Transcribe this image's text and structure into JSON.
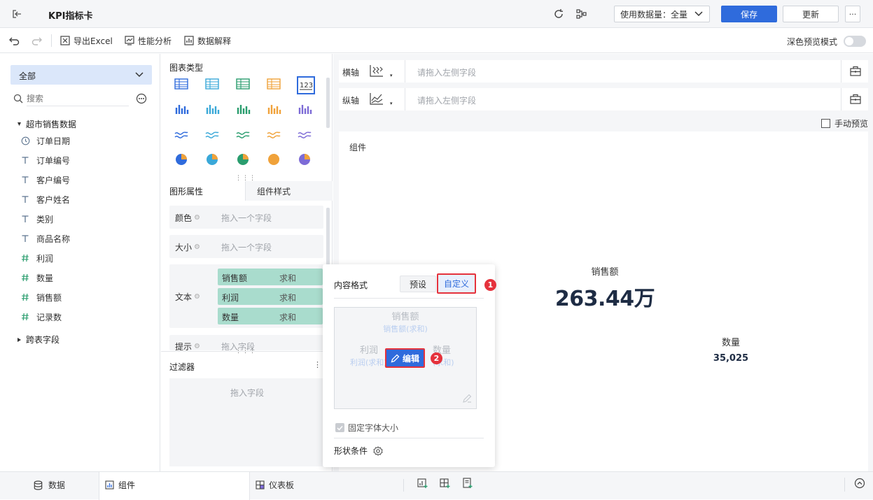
{
  "topbar": {
    "title": "KPI指标卡",
    "data_usage_label": "使用数据量：",
    "data_usage_value": "全量",
    "save_label": "保存",
    "update_label": "更新",
    "more_label": "···"
  },
  "toolbar": {
    "export_label": "导出Excel",
    "performance_label": "性能分析",
    "explain_label": "数据解释",
    "dark_preview_label": "深色预览模式"
  },
  "left": {
    "scope_value": "全部",
    "search_placeholder": "搜索",
    "dataset_name": "超市销售数据",
    "fields": [
      {
        "label": "订单日期",
        "type": "date"
      },
      {
        "label": "订单编号",
        "type": "text"
      },
      {
        "label": "客户编号",
        "type": "text"
      },
      {
        "label": "客户姓名",
        "type": "text"
      },
      {
        "label": "类别",
        "type": "text"
      },
      {
        "label": "商品名称",
        "type": "text"
      },
      {
        "label": "利润",
        "type": "number"
      },
      {
        "label": "数量",
        "type": "number"
      },
      {
        "label": "销售额",
        "type": "number"
      },
      {
        "label": "记录数",
        "type": "number"
      }
    ],
    "cross_table_label": "跨表字段"
  },
  "middle": {
    "chart_type_title": "图表类型",
    "tab_graphic": "图形属性",
    "tab_component": "组件样式",
    "color_label": "颜色",
    "size_label": "大小",
    "text_label": "文本",
    "tooltip_label": "提示",
    "drop_one_placeholder": "拖入一个字段",
    "drop_field_placeholder": "拖入字段",
    "text_pills": [
      {
        "name": "销售额",
        "agg": "求和"
      },
      {
        "name": "利润",
        "agg": "求和"
      },
      {
        "name": "数量",
        "agg": "求和"
      }
    ],
    "filter_title": "过滤器",
    "filter_placeholder": "拖入字段"
  },
  "right": {
    "x_axis_label": "横轴",
    "y_axis_label": "纵轴",
    "axis_placeholder": "请拖入左侧字段",
    "manual_preview_label": "手动预览",
    "component_label": "组件",
    "kpi_main_label": "销售额",
    "kpi_main_value": "263.44万",
    "kpi_sub_label": "数量",
    "kpi_sub_value": "35,025"
  },
  "popup": {
    "content_format_label": "内容格式",
    "preset_label": "预设",
    "custom_label": "自定义",
    "preview_lines": [
      "销售额",
      "销售额(求和)",
      "利润",
      "数量",
      "利润(求和)",
      "(求和)"
    ],
    "edit_label": "编辑",
    "fixed_font_label": "固定字体大小",
    "shape_condition_label": "形状条件",
    "marker_1": "1",
    "marker_2": "2"
  },
  "bottom": {
    "data_tab": "数据",
    "component_tab": "组件",
    "dashboard_tab": "仪表板"
  },
  "colors": {
    "primary": "#2f6bdc",
    "pill": "#a9dccd",
    "marker": "#e5323c",
    "kpi_text": "#1e2c44"
  }
}
